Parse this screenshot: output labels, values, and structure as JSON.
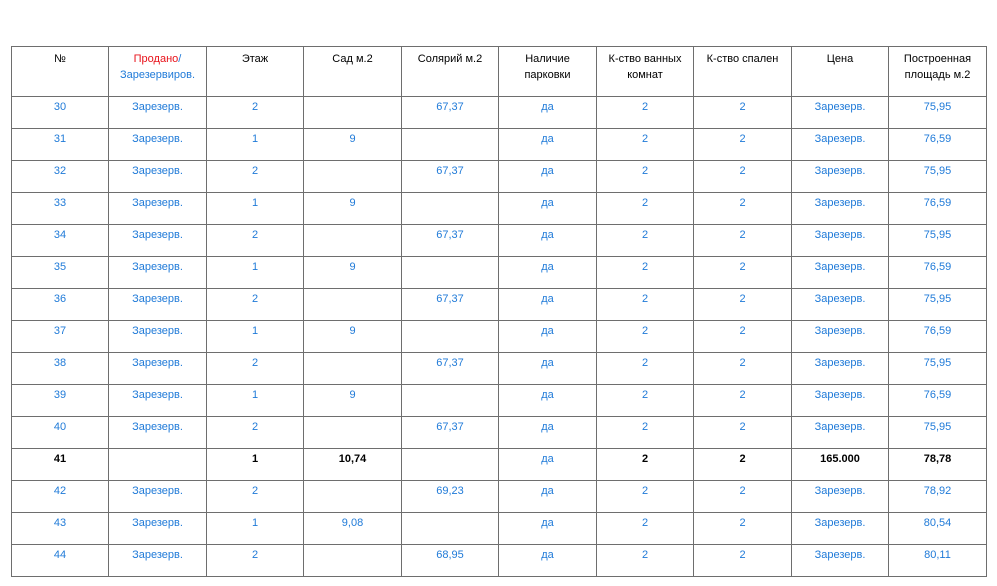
{
  "header": {
    "num": "№",
    "sold_part": "Продано",
    "slash": "/",
    "reserved_part": "Зарезервиров.",
    "floor": "Этаж",
    "garden": "Сад м.2",
    "solarium": "Солярий м.2",
    "parking": "Наличие парковки",
    "bathrooms": "К-ство ванных комнат",
    "bedrooms": "К-ство спален",
    "price": "Цена",
    "area": "Построенная площадь м.2"
  },
  "colors": {
    "sold": "#e8121a",
    "reserved": "#1f7ad8",
    "text": "#000000",
    "border": "#6e6e6e"
  },
  "rows": [
    {
      "num": "30",
      "status": "Зарезерв.",
      "floor": "2",
      "garden": "",
      "solarium": "67,37",
      "parking": "да",
      "bathrooms": "2",
      "bedrooms": "2",
      "price": "Зарезерв.",
      "area": "75,95"
    },
    {
      "num": "31",
      "status": "Зарезерв.",
      "floor": "1",
      "garden": "9",
      "solarium": "",
      "parking": "да",
      "bathrooms": "2",
      "bedrooms": "2",
      "price": "Зарезерв.",
      "area": "76,59"
    },
    {
      "num": "32",
      "status": "Зарезерв.",
      "floor": "2",
      "garden": "",
      "solarium": "67,37",
      "parking": "да",
      "bathrooms": "2",
      "bedrooms": "2",
      "price": "Зарезерв.",
      "area": "75,95"
    },
    {
      "num": "33",
      "status": "Зарезерв.",
      "floor": "1",
      "garden": "9",
      "solarium": "",
      "parking": "да",
      "bathrooms": "2",
      "bedrooms": "2",
      "price": "Зарезерв.",
      "area": "76,59"
    },
    {
      "num": "34",
      "status": "Зарезерв.",
      "floor": "2",
      "garden": "",
      "solarium": "67,37",
      "parking": "да",
      "bathrooms": "2",
      "bedrooms": "2",
      "price": "Зарезерв.",
      "area": "75,95"
    },
    {
      "num": "35",
      "status": "Зарезерв.",
      "floor": "1",
      "garden": "9",
      "solarium": "",
      "parking": "да",
      "bathrooms": "2",
      "bedrooms": "2",
      "price": "Зарезерв.",
      "area": "76,59"
    },
    {
      "num": "36",
      "status": "Зарезерв.",
      "floor": "2",
      "garden": "",
      "solarium": "67,37",
      "parking": "да",
      "bathrooms": "2",
      "bedrooms": "2",
      "price": "Зарезерв.",
      "area": "75,95"
    },
    {
      "num": "37",
      "status": "Зарезерв.",
      "floor": "1",
      "garden": "9",
      "solarium": "",
      "parking": "да",
      "bathrooms": "2",
      "bedrooms": "2",
      "price": "Зарезерв.",
      "area": "76,59"
    },
    {
      "num": "38",
      "status": "Зарезерв.",
      "floor": "2",
      "garden": "",
      "solarium": "67,37",
      "parking": "да",
      "bathrooms": "2",
      "bedrooms": "2",
      "price": "Зарезерв.",
      "area": "75,95"
    },
    {
      "num": "39",
      "status": "Зарезерв.",
      "floor": "1",
      "garden": "9",
      "solarium": "",
      "parking": "да",
      "bathrooms": "2",
      "bedrooms": "2",
      "price": "Зарезерв.",
      "area": "76,59"
    },
    {
      "num": "40",
      "status": "Зарезерв.",
      "floor": "2",
      "garden": "",
      "solarium": "67,37",
      "parking": "да",
      "bathrooms": "2",
      "bedrooms": "2",
      "price": "Зарезерв.",
      "area": "75,95"
    },
    {
      "num": "41",
      "status": "",
      "floor": "1",
      "garden": "10,74",
      "solarium": "",
      "parking": "да",
      "bathrooms": "2",
      "bedrooms": "2",
      "price": "165.000",
      "area": "78,78"
    },
    {
      "num": "42",
      "status": "Зарезерв.",
      "floor": "2",
      "garden": "",
      "solarium": "69,23",
      "parking": "да",
      "bathrooms": "2",
      "bedrooms": "2",
      "price": "Зарезерв.",
      "area": "78,92"
    },
    {
      "num": "43",
      "status": "Зарезерв.",
      "floor": "1",
      "garden": "9,08",
      "solarium": "",
      "parking": "да",
      "bathrooms": "2",
      "bedrooms": "2",
      "price": "Зарезерв.",
      "area": "80,54"
    },
    {
      "num": "44",
      "status": "Зарезерв.",
      "floor": "2",
      "garden": "",
      "solarium": "68,95",
      "parking": "да",
      "bathrooms": "2",
      "bedrooms": "2",
      "price": "Зарезерв.",
      "area": "80,11"
    }
  ]
}
